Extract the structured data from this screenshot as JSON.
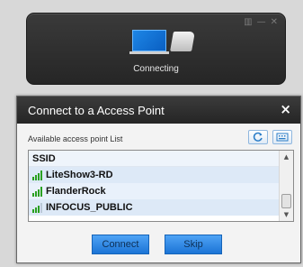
{
  "status_panel": {
    "status_text": "Connecting",
    "window_controls": [
      "▥",
      "—",
      "✕"
    ]
  },
  "dialog": {
    "title": "Connect to a Access Point",
    "close_glyph": "×",
    "list_caption": "Available access point List",
    "column_header": "SSID",
    "access_points": [
      {
        "ssid": "LiteShow3-RD",
        "signal_bars": 4
      },
      {
        "ssid": "FlanderRock",
        "signal_bars": 4
      },
      {
        "ssid": "INFOCUS_PUBLIC",
        "signal_bars": 3
      }
    ],
    "buttons": {
      "connect": "Connect",
      "skip": "Skip"
    },
    "icons": [
      "refresh-icon",
      "keyboard-icon"
    ]
  },
  "colors": {
    "accent": "#1b74d6",
    "signal": "#2aa020",
    "dark_panel": "#2b2b2b"
  }
}
